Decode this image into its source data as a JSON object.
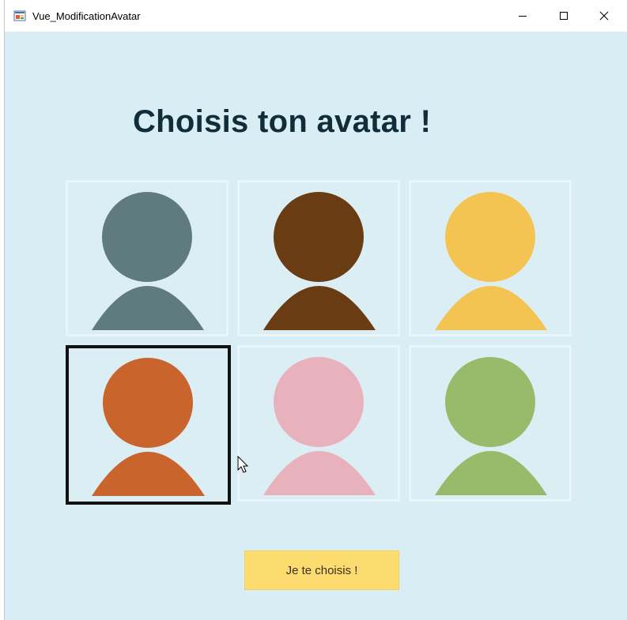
{
  "window": {
    "title": "Vue_ModificationAvatar",
    "controls": [
      "minimize",
      "maximize",
      "close"
    ]
  },
  "page": {
    "title": "Choisis ton avatar !",
    "button_label": "Je te choisis !"
  },
  "avatars": [
    {
      "id": "avatar-slate",
      "color": "#5f7b7f",
      "selected": false
    },
    {
      "id": "avatar-brown",
      "color": "#693c13",
      "selected": false
    },
    {
      "id": "avatar-yellow",
      "color": "#f4c452",
      "selected": false
    },
    {
      "id": "avatar-orange",
      "color": "#c9642d",
      "selected": true
    },
    {
      "id": "avatar-pink",
      "color": "#e8b2bc",
      "selected": false
    },
    {
      "id": "avatar-green",
      "color": "#97bb6a",
      "selected": false
    }
  ],
  "colors": {
    "background": "#d9eef4",
    "title": "#112d3a",
    "button": "#fcdc6e",
    "selected_border": "#111111"
  },
  "icons": [
    "app-icon",
    "minimize-icon",
    "maximize-icon",
    "close-icon",
    "mouse-cursor-icon"
  ]
}
